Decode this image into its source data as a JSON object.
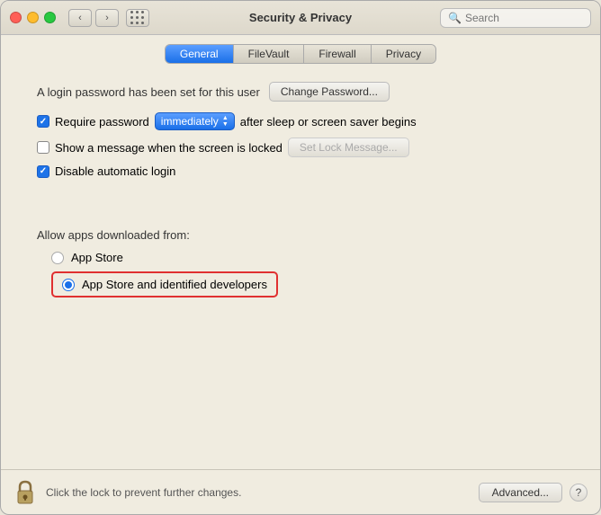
{
  "window": {
    "title": "Security & Privacy"
  },
  "titlebar": {
    "search_placeholder": "Search"
  },
  "tabs": {
    "items": [
      "General",
      "FileVault",
      "Firewall",
      "Privacy"
    ],
    "active": "General"
  },
  "general": {
    "password_set_label": "A login password has been set for this user",
    "change_password_btn": "Change Password...",
    "require_password_label": "Require password",
    "require_password_dropdown": "immediately",
    "after_sleep_label": "after sleep or screen saver begins",
    "show_message_label": "Show a message when the screen is locked",
    "set_lock_message_btn": "Set Lock Message...",
    "disable_autologin_label": "Disable automatic login",
    "allow_apps_label": "Allow apps downloaded from:",
    "app_store_option": "App Store",
    "app_store_identified_option": "App Store and identified developers"
  },
  "bottombar": {
    "lock_label": "Click the lock to prevent further changes.",
    "advanced_btn": "Advanced...",
    "question_btn": "?"
  }
}
